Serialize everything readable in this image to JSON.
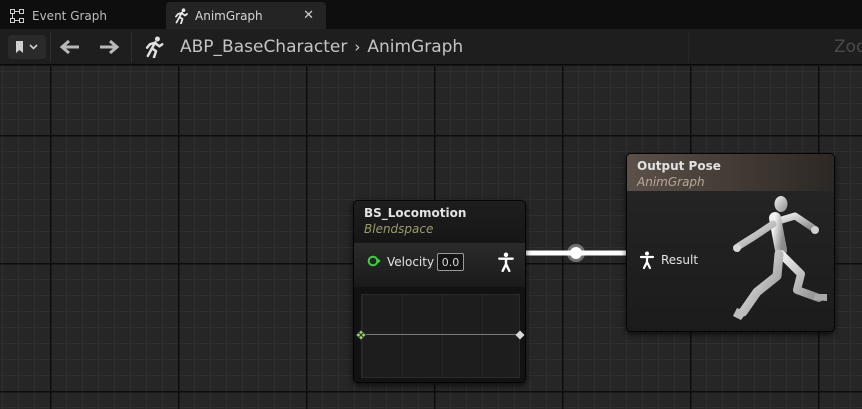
{
  "tabs": [
    {
      "label": "Event Graph",
      "icon": "event-graph-icon",
      "active": false
    },
    {
      "label": "AnimGraph",
      "icon": "running-man-icon",
      "active": true,
      "close": "✕"
    }
  ],
  "toolbar": {
    "bookmark_icon": "bookmark-icon",
    "back_icon": "arrow-left-icon",
    "forward_icon": "arrow-right-icon",
    "breadcrumb": {
      "icon": "running-man-icon",
      "items": [
        "ABP_BaseCharacter",
        "AnimGraph"
      ],
      "separator": "›"
    },
    "zoom_text": "Zoo"
  },
  "nodes": {
    "blendspace": {
      "title": "BS_Locomotion",
      "subtitle": "Blendspace",
      "input_label": "Velocity",
      "input_value": "0.0",
      "pin_color": "#3ecf3e"
    },
    "output_pose": {
      "title": "Output Pose",
      "subtitle": "AnimGraph",
      "input_label": "Result"
    }
  },
  "colors": {
    "canvas": "#262626",
    "wire": "#ffffff",
    "output_header": "#5b5149",
    "blendspace_subtitle": "#9b9b70"
  }
}
